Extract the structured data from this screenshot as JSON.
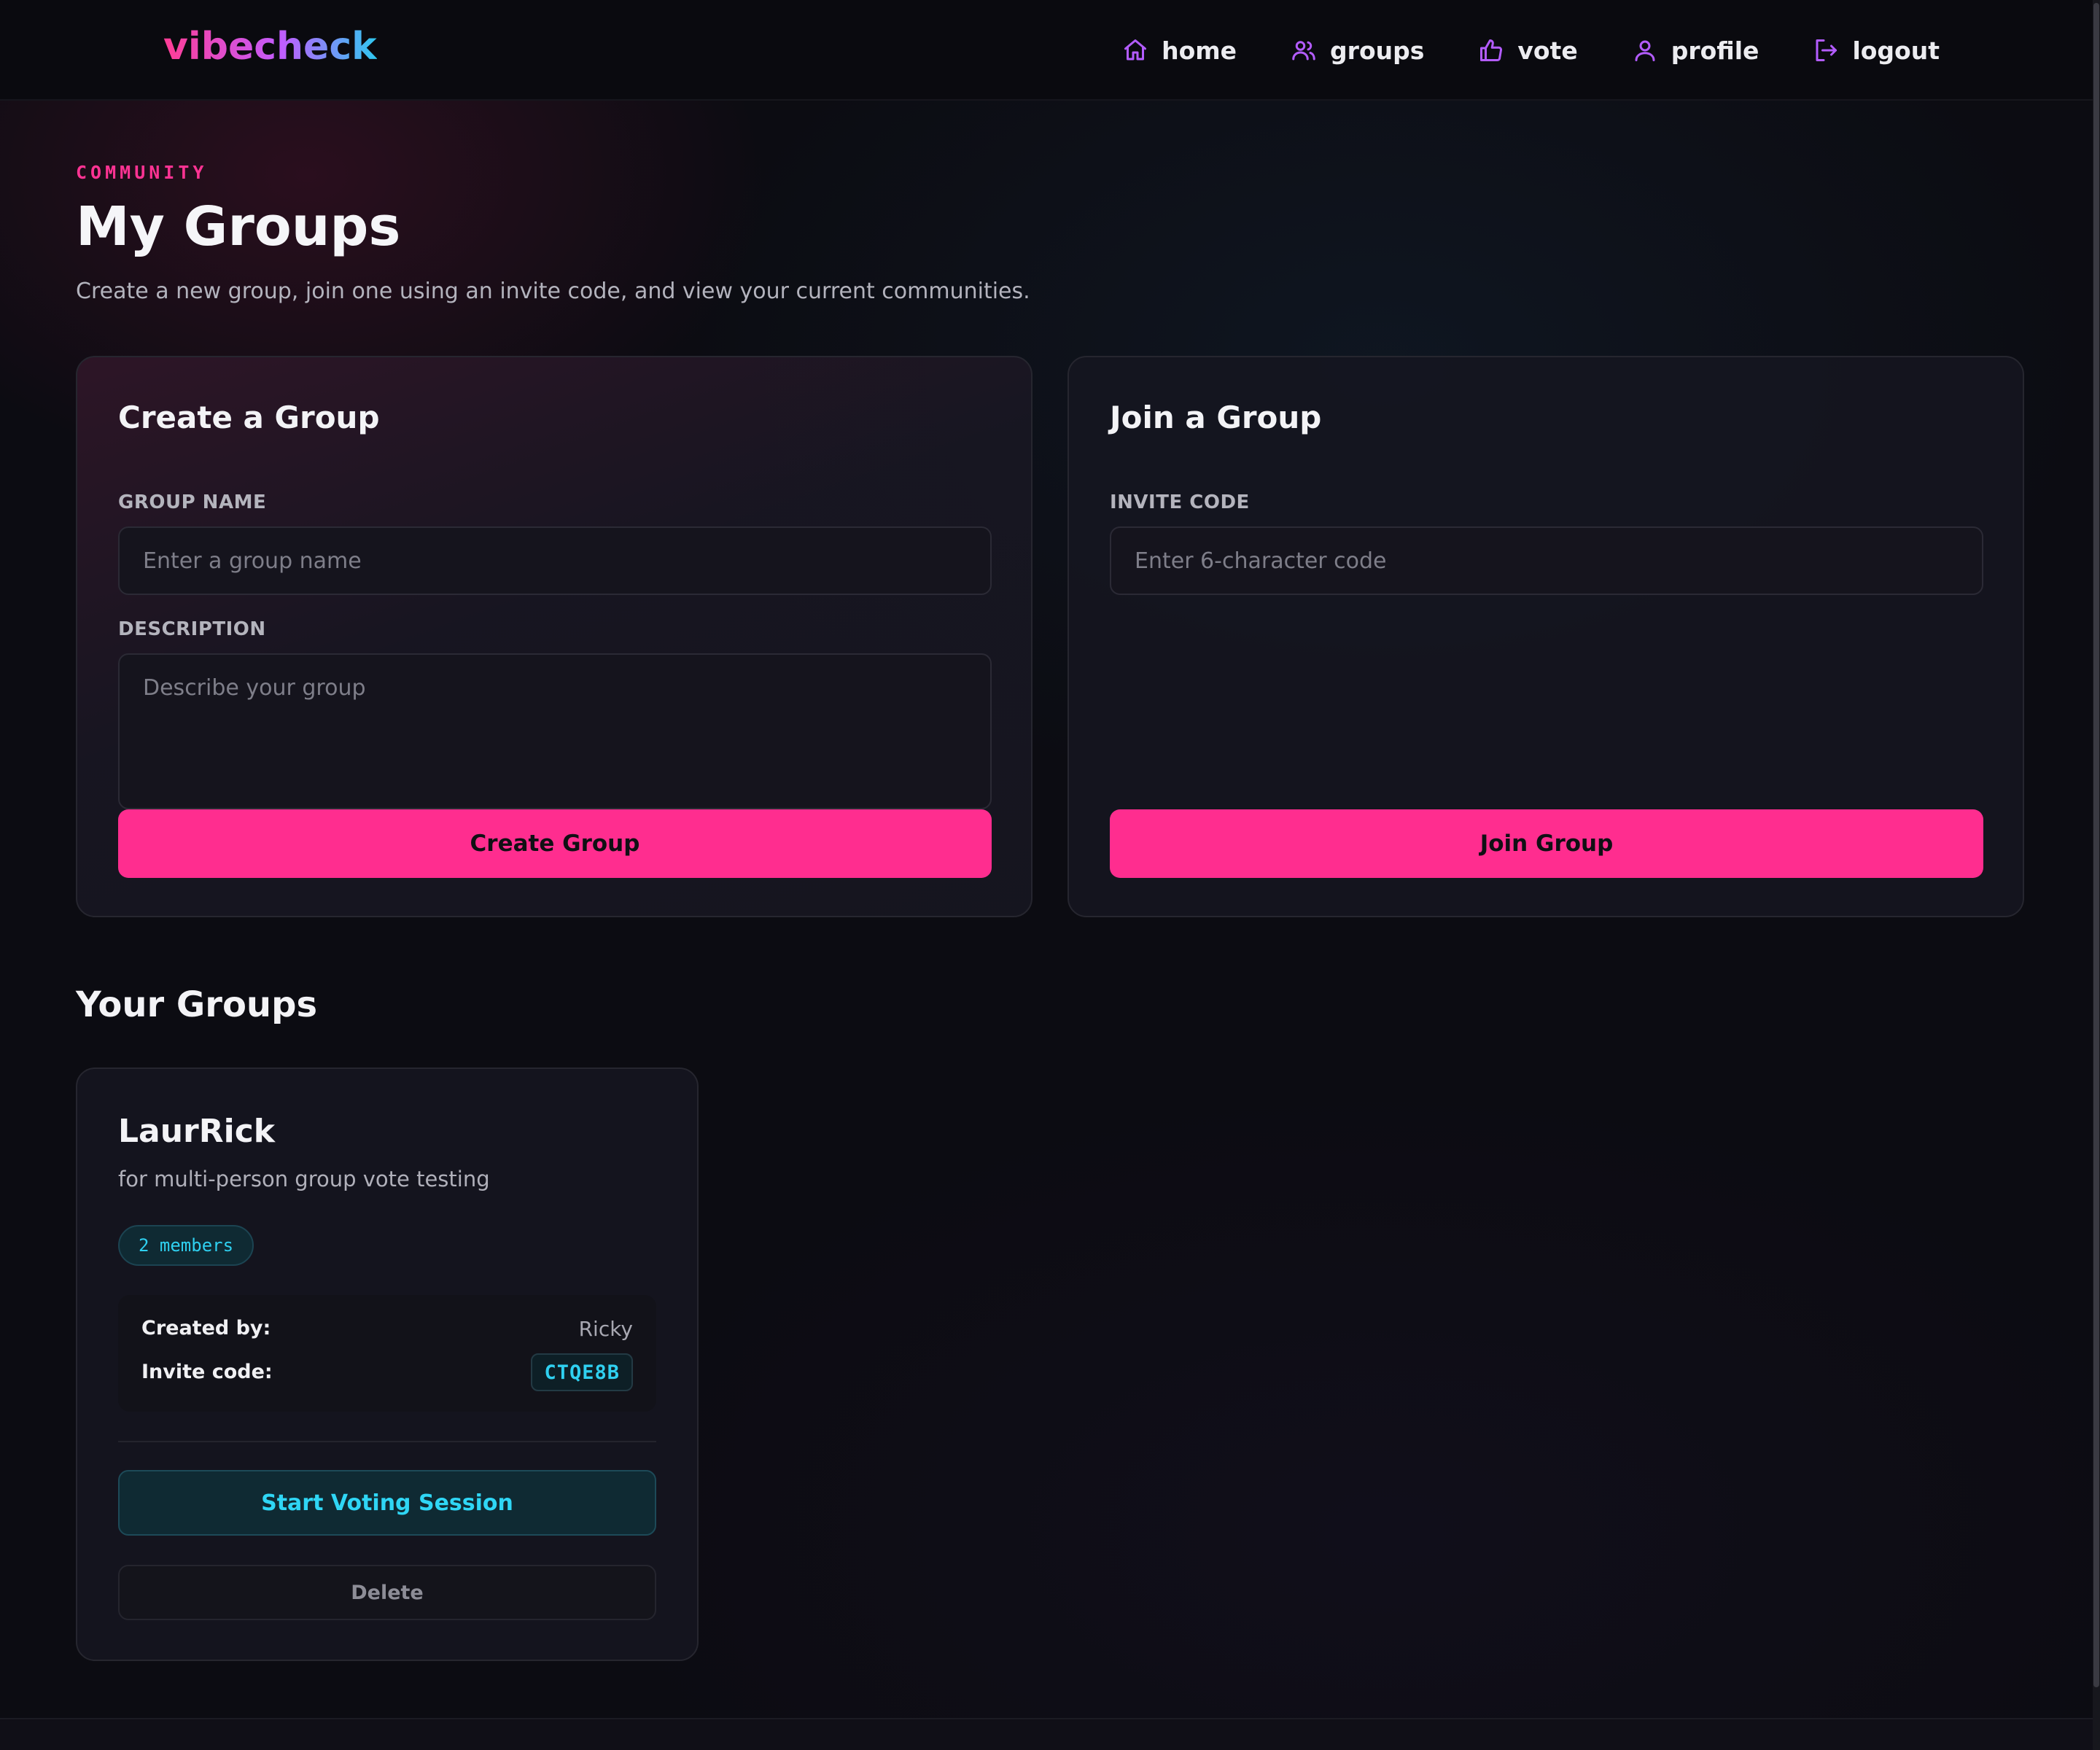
{
  "app": {
    "logo": "vibecheck",
    "accent": "#ff2d8f",
    "cyan": "#2fd0f0",
    "icon_color": "#b35cff"
  },
  "nav": {
    "items": [
      {
        "label": "home",
        "icon": "home-icon"
      },
      {
        "label": "groups",
        "icon": "users-icon"
      },
      {
        "label": "vote",
        "icon": "thumbs-up-icon"
      },
      {
        "label": "profile",
        "icon": "user-icon"
      },
      {
        "label": "logout",
        "icon": "logout-icon"
      }
    ]
  },
  "header": {
    "eyebrow": "COMMUNITY",
    "title": "My Groups",
    "subtitle": "Create a new group, join one using an invite code, and view your current communities."
  },
  "create": {
    "title": "Create a Group",
    "name_label": "GROUP NAME",
    "name_placeholder": "Enter a group name",
    "name_value": "",
    "desc_label": "DESCRIPTION",
    "desc_placeholder": "Describe your group",
    "desc_value": "",
    "button": "Create Group"
  },
  "join": {
    "title": "Join a Group",
    "code_label": "INVITE CODE",
    "code_placeholder": "Enter 6-character code",
    "code_value": "",
    "button": "Join Group"
  },
  "groups": {
    "section_title": "Your Groups",
    "items": [
      {
        "name": "LaurRick",
        "description": "for multi-person group vote testing",
        "members": "2 members",
        "created_by_label": "Created by:",
        "created_by": "Ricky",
        "invite_label": "Invite code:",
        "invite_code": "CTQE8B",
        "start_button": "Start Voting Session",
        "delete_button": "Delete"
      }
    ]
  }
}
